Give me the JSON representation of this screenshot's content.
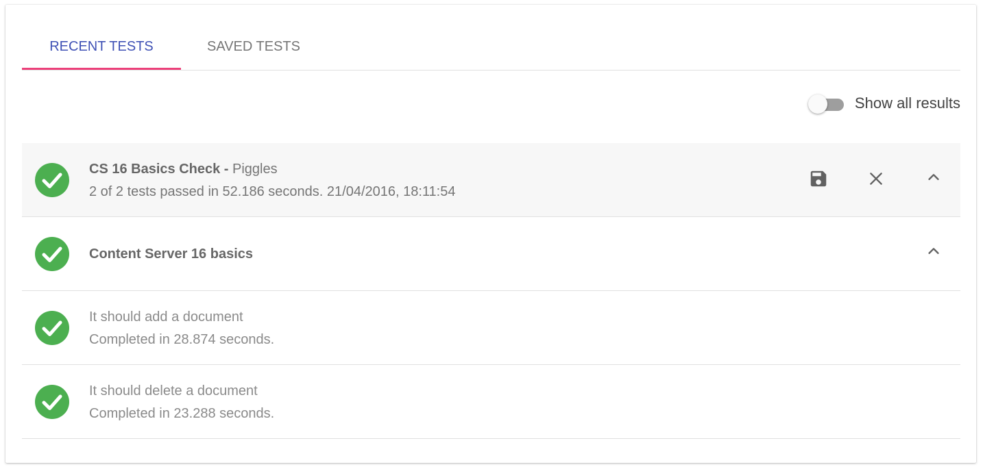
{
  "tabs": [
    {
      "label": "RECENT TESTS",
      "active": true
    },
    {
      "label": "SAVED TESTS",
      "active": false
    }
  ],
  "colors": {
    "tab_active": "#3f51b5",
    "tab_indicator": "#ec407a",
    "success": "#4caf50"
  },
  "toggle": {
    "label": "Show all results",
    "checked": false
  },
  "suite": {
    "title": "CS 16 Basics Check",
    "separator": " - ",
    "owner": "Piggles",
    "summary": "2 of 2 tests passed in 52.186 seconds. 21/04/2016, 18:11:54",
    "status_icon": "check-circle-icon",
    "actions": [
      "save-icon",
      "close-icon",
      "chevron-up-icon"
    ]
  },
  "group": {
    "title": "Content Server 16 basics",
    "status_icon": "check-circle-icon",
    "actions": [
      "chevron-up-icon"
    ]
  },
  "tests": [
    {
      "name": "It should add a document",
      "result": "Completed in 28.874 seconds.",
      "status_icon": "check-circle-icon"
    },
    {
      "name": "It should delete a document",
      "result": "Completed in 23.288 seconds.",
      "status_icon": "check-circle-icon"
    }
  ]
}
